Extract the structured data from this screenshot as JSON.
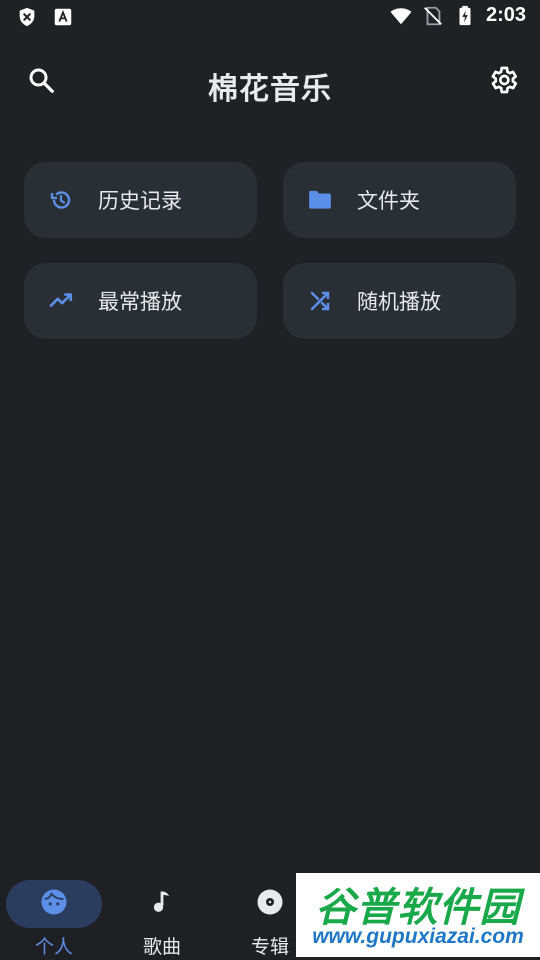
{
  "status_bar": {
    "time": "2:03",
    "left_icons": [
      "shield-x-icon",
      "text-a-icon"
    ],
    "right_icons": [
      "wifi-icon",
      "no-sim-icon",
      "battery-charging-icon"
    ]
  },
  "header": {
    "title": "棉花音乐",
    "search_icon": "search-icon",
    "settings_icon": "gear-icon"
  },
  "cards": [
    {
      "label": "历史记录",
      "icon": "history-icon"
    },
    {
      "label": "文件夹",
      "icon": "folder-icon"
    },
    {
      "label": "最常播放",
      "icon": "trending-up-icon"
    },
    {
      "label": "随机播放",
      "icon": "shuffle-icon"
    }
  ],
  "bottom_nav": {
    "items": [
      {
        "label": "个人",
        "icon": "face-icon",
        "active": true
      },
      {
        "label": "歌曲",
        "icon": "music-note-icon",
        "active": false
      },
      {
        "label": "专辑",
        "icon": "album-icon",
        "active": false
      }
    ]
  },
  "watermark": {
    "logo_text": "谷普软件园",
    "url": "www.gupuxiazai.com"
  },
  "colors": {
    "background": "#202124",
    "card": "#2a2e35",
    "accent": "#5b8fe8",
    "active_pill": "#2b3d5e",
    "text": "#e8eaed"
  }
}
